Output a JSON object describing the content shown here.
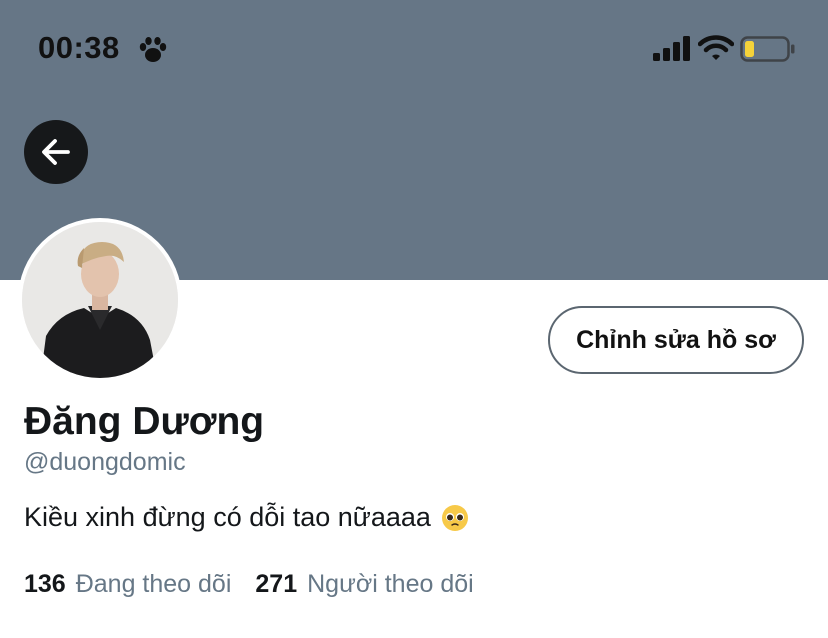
{
  "status_bar": {
    "time": "00:38",
    "icons": [
      "paw-icon",
      "signal-bars-icon",
      "wifi-icon",
      "battery-low-icon"
    ]
  },
  "colors": {
    "banner": "#667686",
    "text_primary": "#14171a",
    "text_secondary": "#667786",
    "battery_level": "#f5d33a"
  },
  "nav": {
    "back_icon": "arrow-left-icon"
  },
  "profile": {
    "display_name": "Đăng Dương",
    "handle": "@duongdomic",
    "bio": "Kiều xinh đừng có dỗi tao nữaaaa",
    "bio_emoji_icon": "pleading-face-emoji-icon",
    "edit_button_label": "Chỉnh sửa hồ sơ"
  },
  "stats": {
    "following_count": "136",
    "following_label": "Đang theo dõi",
    "followers_count": "271",
    "followers_label": "Người theo dõi"
  }
}
